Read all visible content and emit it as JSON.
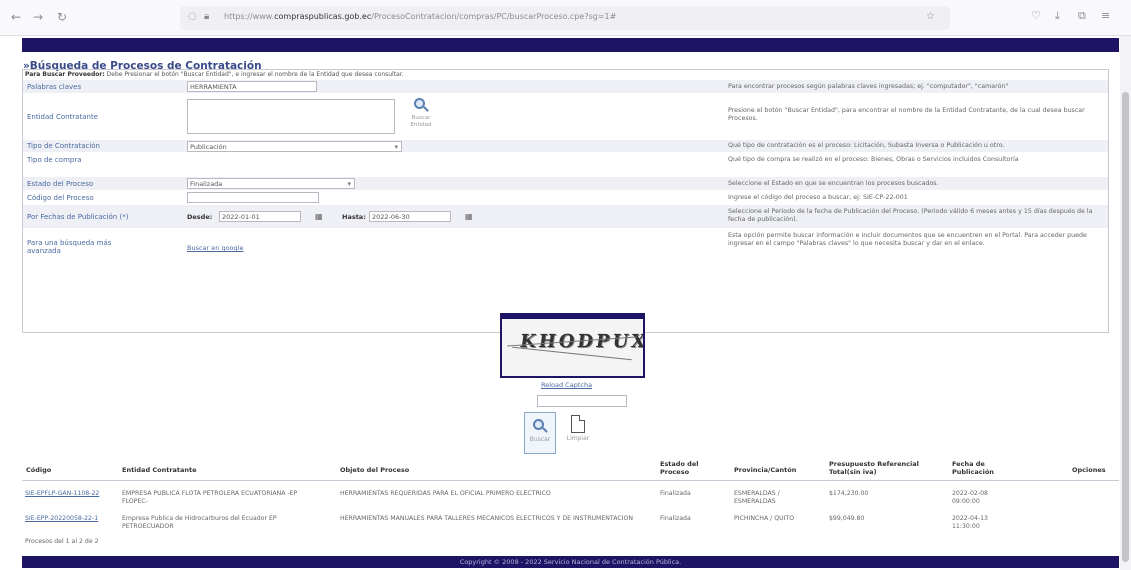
{
  "browser": {
    "url_prefix": "https://www.",
    "url_domain": "compraspublicas.gob.ec",
    "url_path": "/ProcesoContratacion/compras/PC/buscarProceso.cpe?sg=1#"
  },
  "page": {
    "title": "»Búsqueda de Procesos de Contratación",
    "help_bold": "Para Buscar Proveedor:",
    "help_text": " Debe Presionar el botón \"Buscar Entidad\", e ingresar el nombre de la Entidad que desea consultar."
  },
  "form": {
    "palabras_label": "Palabras claves",
    "palabras_value": "HERRAMIENTA",
    "palabras_desc": "Para encontrar procesos según palabras claves ingresadas; ej. \"computador\", \"camarón\"",
    "entidad_label": "Entidad Contratante",
    "entidad_button_label": "Buscar Entidad",
    "entidad_desc": "Presione el botón \"Buscar Entidad\", para encontrar el nombre de la Entidad Contratante, de la cual desea buscar Procesos.",
    "tipo_contratacion_label": "Tipo de Contratación",
    "tipo_contratacion_value": "Publicación",
    "tipo_contratacion_desc": "Qué tipo de contratación es el proceso: Licitación, Subasta Inversa o Publicación u otro.",
    "tipo_compra_label": "Tipo de compra",
    "tipo_compra_desc": "Qué tipo de compra se realizó en el proceso: Bienes, Obras o Servicios incluidos Consultoría",
    "estado_label": "Estado del Proceso",
    "estado_value": "Finalizada",
    "estado_desc": "Seleccione el Estado en que se encuentran los procesos buscados.",
    "codigo_label": "Código del Proceso",
    "codigo_desc": "Ingrese el código del proceso a buscar, ej: SIE-CP-22-001",
    "fechas_label": "Por Fechas de Publicación (*)",
    "desde_label": "Desde:",
    "desde_value": "2022-01-01",
    "hasta_label": "Hasta:",
    "hasta_value": "2022-06-30",
    "fechas_desc": "Seleccione el Periodo de la fecha de Publicación del Proceso. (Periodo válido 6 meses antes y 15 días después de la fecha de publicación).",
    "avanzada_label": "Para una búsqueda más avanzada",
    "avanzada_link": "Buscar en google",
    "avanzada_desc": "Esta opción permite buscar información e incluir documentos que se encuentren en el Portal. Para acceder puede ingresar en el campo \"Palabras claves\" lo que necesita buscar y dar en el enlace."
  },
  "captcha": {
    "text": "KHODPUX",
    "reload_label": "Reload Captcha",
    "buscar_label": "Buscar",
    "limpiar_label": "Limpiar"
  },
  "results": {
    "headers": [
      "Código",
      "Entidad Contratante",
      "Objeto del Proceso",
      "Estado del Proceso",
      "Provincia/Cantón",
      "Presupuesto Referencial Total(sin iva)",
      "Fecha de Publicación",
      "Opciones"
    ],
    "rows": [
      {
        "codigo": "SIE-EPFLP-GAN-1108-22",
        "entidad": "EMPRESA PUBLICA FLOTA PETROLERA ECUATORIANA -EP FLOPEC-",
        "objeto": "HERRAMIENTAS REQUERIDAS PARA EL OFICIAL PRIMERO ELECTRICO",
        "estado": "Finalizada",
        "provincia": "ESMERALDAS / ESMERALDAS",
        "presupuesto": "$174,230.00",
        "fecha": "2022-02-08 09:00:00"
      },
      {
        "codigo": "SIE-EPP-20220058-22-1",
        "entidad": "Empresa Publica de Hidrocarburos del Ecuador EP PETROECUADOR",
        "objeto": "HERRAMIENTAS MANUALES PARA TALLERES MECANICOS ELECTRICOS Y DE INSTRUMENTACION",
        "estado": "Finalizada",
        "provincia": "PICHINCHA / QUITO",
        "presupuesto": "$99,049.80",
        "fecha": "2022-04-13 11:30:00"
      }
    ],
    "count_text": "Procesos del 1 al 2 de 2"
  },
  "footer": "Copyright © 2008 - 2022 Servicio Nacional de Contratación Pública."
}
